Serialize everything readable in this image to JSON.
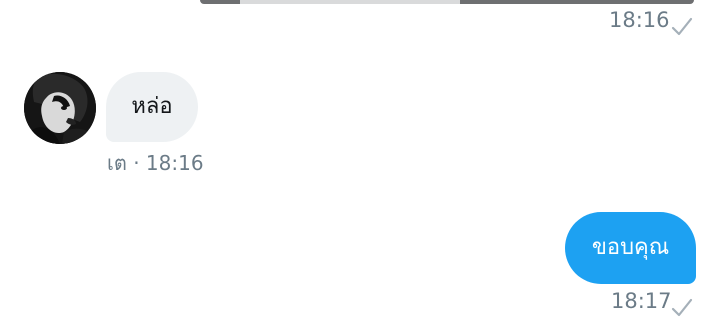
{
  "top_message": {
    "time": "18:16"
  },
  "incoming_message": {
    "text": "หล่อ",
    "sender": "เต",
    "separator": "·",
    "time": "18:16"
  },
  "outgoing_message": {
    "text": "ขอบคุณ",
    "time": "18:17"
  },
  "colors": {
    "outgoing_bubble": "#1da1f2",
    "incoming_bubble": "#eef1f3",
    "timestamp": "#6b7b87",
    "check": "#a5b0b9"
  },
  "icons": {
    "sent_status": "checkmark-icon"
  }
}
